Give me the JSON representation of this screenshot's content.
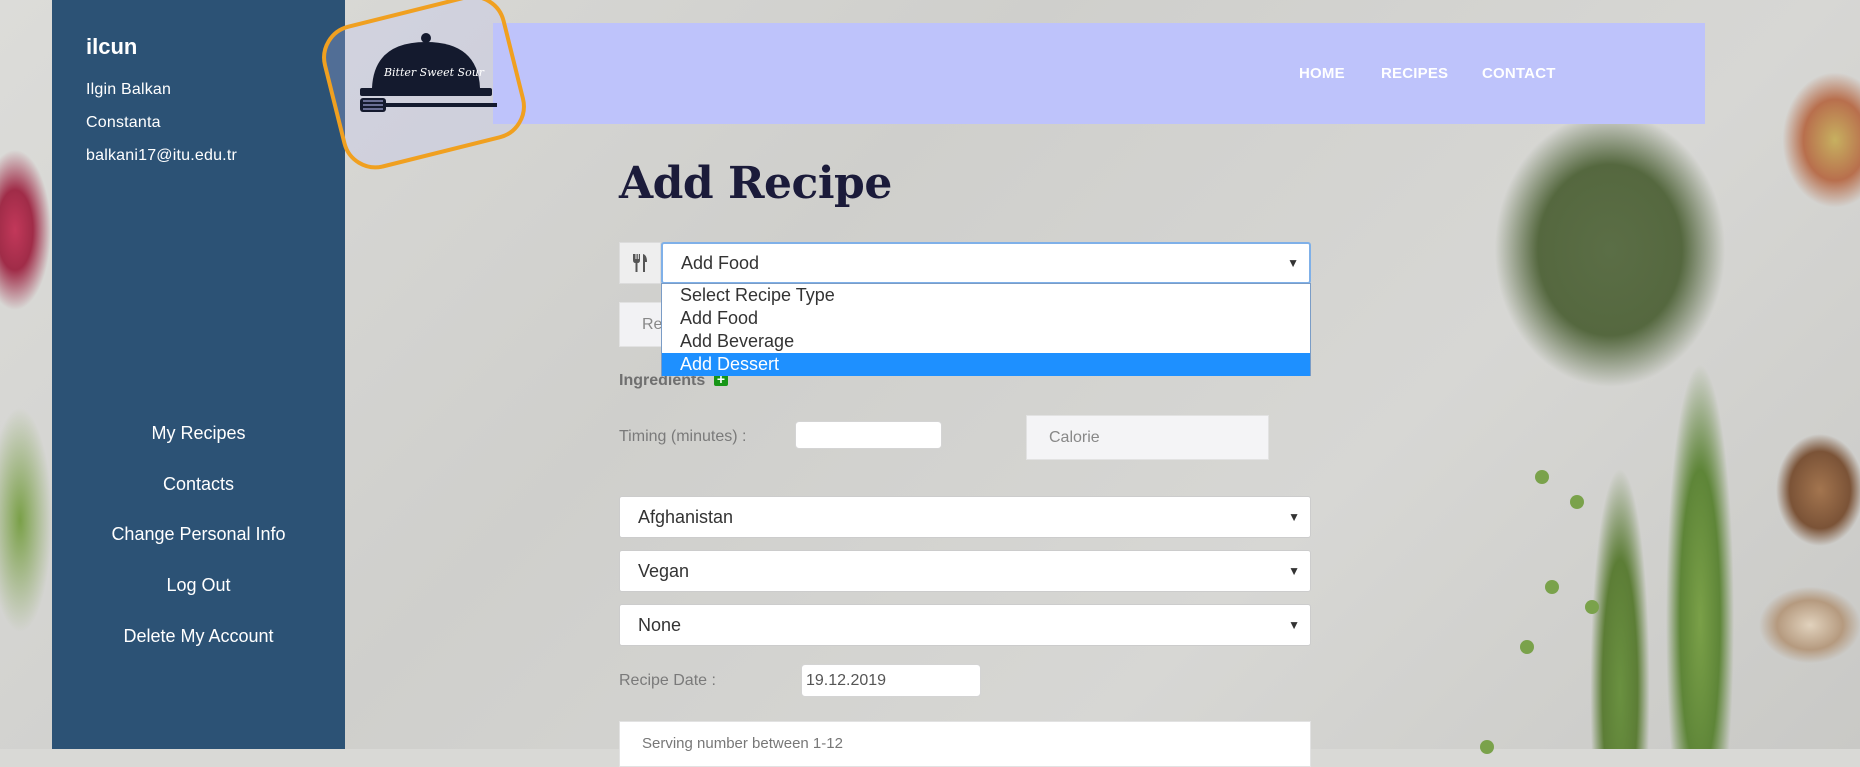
{
  "sidebar": {
    "username": "ilcun",
    "full_name": "Ilgin Balkan",
    "city": "Constanta",
    "email": "balkani17@itu.edu.tr",
    "menu": [
      "My Recipes",
      "Contacts",
      "Change Personal Info",
      "Log Out",
      "Delete My Account"
    ]
  },
  "logo": {
    "text": "Bitter Sweet Sour"
  },
  "nav": {
    "home": "HOME",
    "recipes": "RECIPES",
    "contact": "CONTACT"
  },
  "form": {
    "title": "Add Recipe",
    "recipe_type": {
      "value": "Add Food",
      "options": [
        "Select Recipe Type",
        "Add Food",
        "Add Beverage",
        "Add Dessert"
      ],
      "highlighted": "Add Dessert"
    },
    "recipe_name_placeholder": "Re",
    "ingredients_label": "Ingredients",
    "timing_label": "Timing (minutes) :",
    "timing_value": "",
    "calorie_placeholder": "Calorie",
    "country": "Afghanistan",
    "diet": "Vegan",
    "allergy": "None",
    "date_label": "Recipe Date :",
    "date_value": "19.12.2019",
    "serving_placeholder": "Serving number between 1-12"
  },
  "colors": {
    "sidebar": "#2c5275",
    "header": "#bec3fb",
    "logo_frame": "#f0a020",
    "dropdown_highlight": "#1e90ff"
  }
}
